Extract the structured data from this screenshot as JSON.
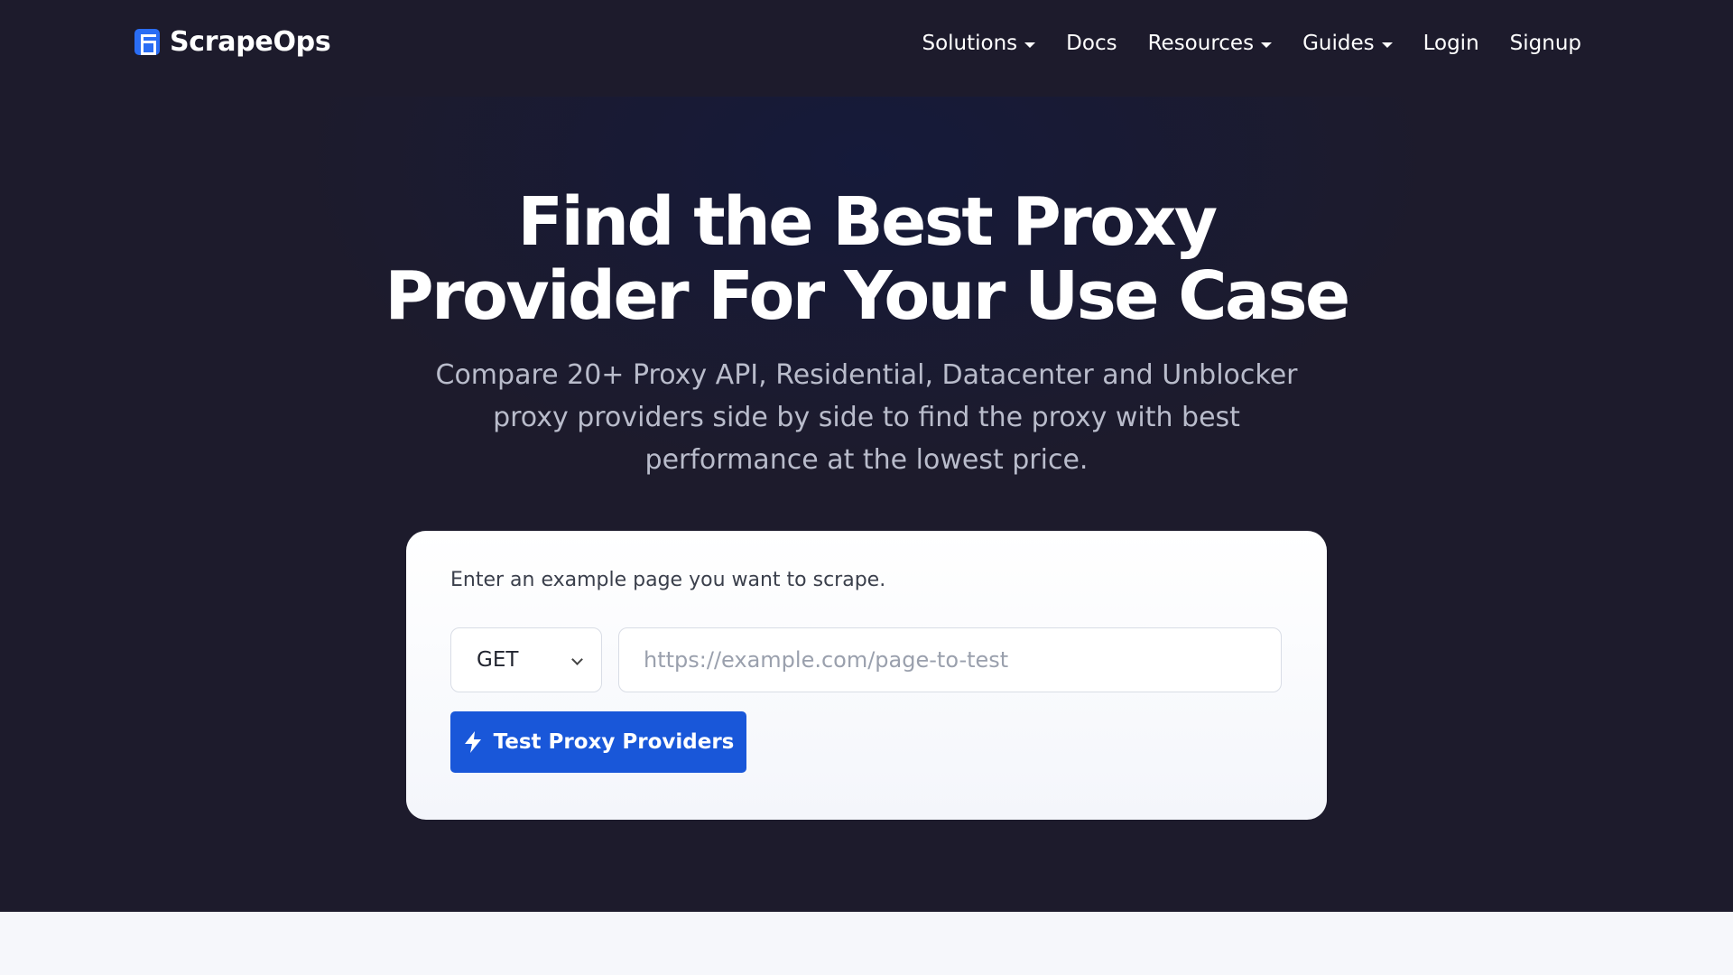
{
  "navbar": {
    "brand": "ScrapeOps",
    "items": [
      {
        "label": "Solutions",
        "dropdown": true
      },
      {
        "label": "Docs",
        "dropdown": false
      },
      {
        "label": "Resources",
        "dropdown": true
      },
      {
        "label": "Guides",
        "dropdown": true
      },
      {
        "label": "Login",
        "dropdown": false
      },
      {
        "label": "Signup",
        "dropdown": false
      }
    ]
  },
  "hero": {
    "title_line1": "Find the Best Proxy",
    "title_line2": "Provider For Your Use Case",
    "subtitle_line1": "Compare 20+ Proxy API, Residential, Datacenter and Unblocker",
    "subtitle_line2": "proxy providers side by side to find the proxy with best",
    "subtitle_line3": "performance at the lowest price."
  },
  "form": {
    "label": "Enter an example page you want to scrape.",
    "method": "GET",
    "url_value": "",
    "url_placeholder": "https://example.com/page-to-test",
    "button_label": "Test Proxy Providers",
    "button_icon": "bolt-icon"
  },
  "colors": {
    "navbar_bg": "#1d1b2c",
    "hero_bg": "#1d1b2c",
    "accent": "#1957d9",
    "logo": "#2a6df4"
  }
}
